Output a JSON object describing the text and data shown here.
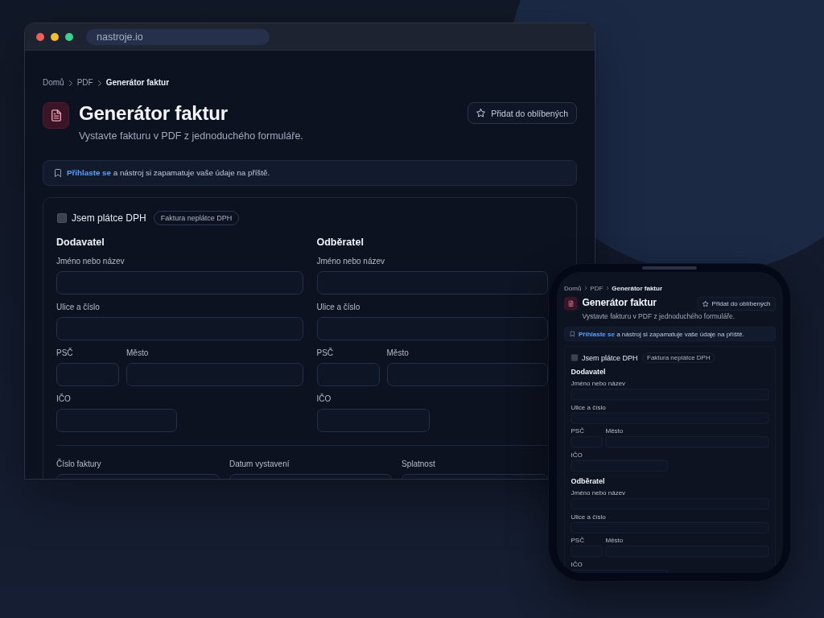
{
  "browser": {
    "url": "nastroje.io",
    "page": {
      "breadcrumb": [
        {
          "label": "Domů",
          "current": false
        },
        {
          "label": "PDF",
          "current": false
        },
        {
          "label": "Generátor faktur",
          "current": true
        }
      ],
      "title": "Generátor faktur",
      "subtitle": "Vystavte fakturu v PDF z jednoduchého formuláře.",
      "favorite_button": "Přidat do oblíbených",
      "login_notice": {
        "link": "Přihlaste se",
        "text": "a nástroj si zapamatuje vaše údaje na příště."
      },
      "vat_payer": {
        "label": "Jsem plátce DPH",
        "checked": false
      },
      "invoice_type_badge": "Faktura neplátce DPH",
      "parties": [
        {
          "heading": "Dodavatel",
          "fields": [
            {
              "kind": "name",
              "label": "Jméno nebo název"
            },
            {
              "kind": "street",
              "label": "Ulice a číslo"
            },
            {
              "kind": "zip",
              "label": "PSČ"
            },
            {
              "kind": "city",
              "label": "Město"
            },
            {
              "kind": "id",
              "label": "IČO"
            }
          ]
        },
        {
          "heading": "Odběratel",
          "fields": [
            {
              "kind": "name",
              "label": "Jméno nebo název"
            },
            {
              "kind": "street",
              "label": "Ulice a číslo"
            },
            {
              "kind": "zip",
              "label": "PSČ"
            },
            {
              "kind": "city",
              "label": "Město"
            },
            {
              "kind": "id",
              "label": "IČO"
            }
          ]
        }
      ],
      "invoice_fields": [
        {
          "label": "Číslo faktury"
        },
        {
          "label": "Datum vystavení"
        },
        {
          "label": "Splatnost"
        }
      ]
    }
  },
  "phone": {
    "page": {
      "breadcrumb": [
        {
          "label": "Domů",
          "current": false
        },
        {
          "label": "PDF",
          "current": false
        },
        {
          "label": "Generátor faktur",
          "current": true
        }
      ],
      "title": "Generátor faktur",
      "subtitle": "Vystavte fakturu v PDF z jednoduchého formuláře.",
      "favorite_button": "Přidat do oblíbených",
      "login_notice": {
        "link": "Přihlaste se",
        "text": "a nástroj si zapamatuje vaše údaje na příště."
      },
      "vat_payer": {
        "label": "Jsem plátce DPH",
        "checked": false
      },
      "invoice_type_badge": "Faktura neplátce DPH",
      "parties": [
        {
          "heading": "Dodavatel",
          "fields": [
            {
              "kind": "name",
              "label": "Jméno nebo název"
            },
            {
              "kind": "street",
              "label": "Ulice a číslo"
            },
            {
              "kind": "zip",
              "label": "PSČ"
            },
            {
              "kind": "city",
              "label": "Město"
            },
            {
              "kind": "id",
              "label": "IČO"
            }
          ]
        },
        {
          "heading": "Odběratel",
          "fields": [
            {
              "kind": "name",
              "label": "Jméno nebo název"
            },
            {
              "kind": "street",
              "label": "Ulice a číslo"
            },
            {
              "kind": "zip",
              "label": "PSČ"
            },
            {
              "kind": "city",
              "label": "Město"
            },
            {
              "kind": "id",
              "label": "IČO"
            }
          ]
        }
      ]
    }
  }
}
